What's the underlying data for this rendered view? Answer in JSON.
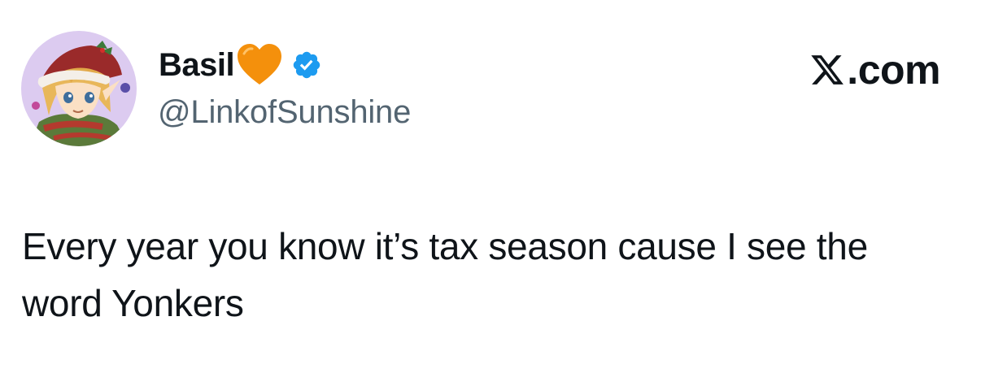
{
  "author": {
    "display_name": "Basil",
    "name_emoji": "orange-heart",
    "verified": true,
    "handle": "@LinkofSunshine",
    "avatar": "avatar-christmas-elf-character"
  },
  "brand": {
    "icon": "x-logo",
    "label": ".com"
  },
  "tweet": {
    "text": "Every year you know it’s tax season cause I see the word Yonkers"
  },
  "colors": {
    "text": "#0f1419",
    "secondary": "#536471",
    "verified_blue": "#1d9bf0",
    "heart_orange": "#f4900c",
    "avatar_bg": "#d9c9ef"
  }
}
